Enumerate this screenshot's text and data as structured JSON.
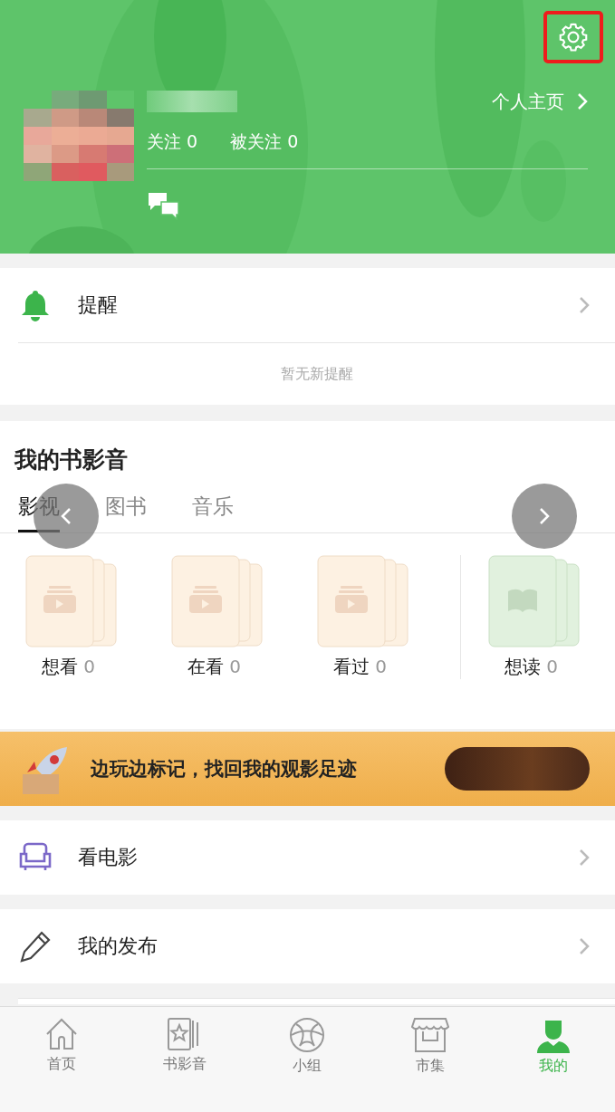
{
  "header": {
    "settings": {
      "highlighted": true
    },
    "profile_link": "个人主页",
    "following": "关注 0",
    "followers": "被关注 0"
  },
  "reminder": {
    "title": "提醒",
    "empty_text": "暂无新提醒"
  },
  "library": {
    "title": "我的书影音",
    "tabs": [
      {
        "label": "影视",
        "selected": true
      },
      {
        "label": "图书",
        "selected": false
      },
      {
        "label": "音乐",
        "selected": false
      }
    ],
    "shelves": [
      {
        "label": "想看",
        "count": "0",
        "kind": "video"
      },
      {
        "label": "在看",
        "count": "0",
        "kind": "video"
      },
      {
        "label": "看过",
        "count": "0",
        "kind": "video"
      },
      {
        "label": "想读",
        "count": "0",
        "kind": "book"
      }
    ]
  },
  "banner": {
    "text": "边玩边标记，找回我的观影足迹"
  },
  "menu": [
    {
      "label": "看电影",
      "kind": "sofa"
    },
    {
      "label": "我的发布",
      "kind": "pencil"
    }
  ],
  "tab_bar": [
    {
      "label": "首页",
      "kind": "home",
      "selected": false
    },
    {
      "label": "书影音",
      "kind": "media",
      "selected": false
    },
    {
      "label": "小组",
      "kind": "group",
      "selected": false
    },
    {
      "label": "市集",
      "kind": "market",
      "selected": false
    },
    {
      "label": "我的",
      "kind": "me",
      "selected": true
    }
  ]
}
